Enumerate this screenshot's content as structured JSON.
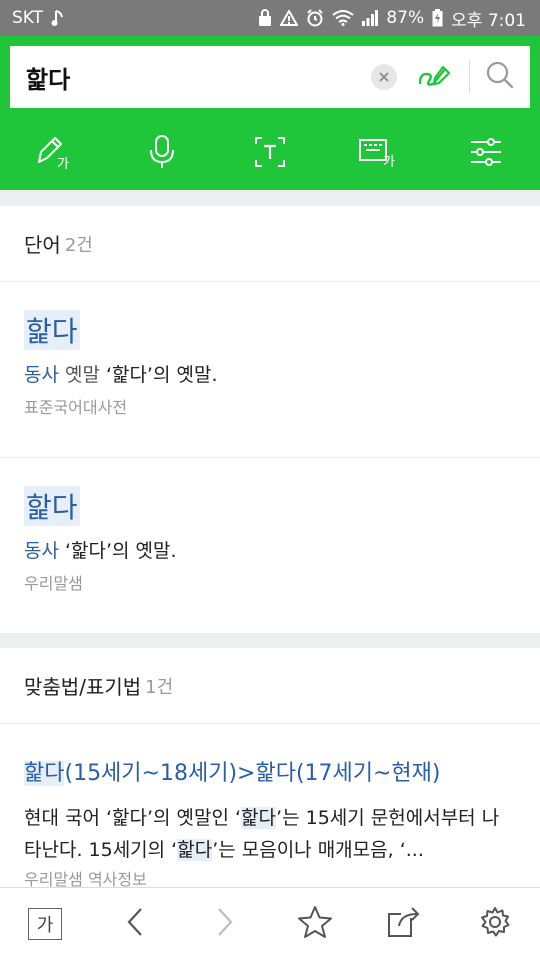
{
  "status_bar": {
    "carrier": "SKT",
    "battery": "87%",
    "time": "오후 7:01"
  },
  "search": {
    "query": "핥다",
    "icons": [
      "clear-icon",
      "handwriting-pen-icon",
      "search-icon"
    ]
  },
  "toolbar": {
    "tools": [
      "handwriting-input-icon",
      "microphone-icon",
      "text-recognition-icon",
      "keyboard-korean-icon",
      "settings-sliders-icon"
    ]
  },
  "words_section": {
    "title": "단어",
    "count": "2건",
    "entries": [
      {
        "word": "핥다",
        "pos": "동사",
        "sub": "옛말",
        "definition": "‘핥다’의 옛말.",
        "source": "표준국어대사전"
      },
      {
        "word": "핥다",
        "pos": "동사",
        "definition": "‘핥다’의 옛말.",
        "source": "우리말샘"
      }
    ]
  },
  "spelling_section": {
    "title": "맞춤법/표기법",
    "count": "1건",
    "entry": {
      "title_a": "핥다",
      "title_b": "(15세기~18세기)>핥다(17세기~현재)",
      "body_1": "현대 국어 ‘핥다’의 옛말인 ‘",
      "body_hl_1": "핥다",
      "body_2": "’는 15세기 문헌에서부터 나타난다. 15세기의 ‘",
      "body_hl_2": "핥다",
      "body_3": "’는 모음이나 매개모음, ‘...",
      "source": "우리말샘 역사정보"
    }
  },
  "bottom_bar": {
    "font_label": "가",
    "icons": [
      "font-size-icon",
      "back-icon",
      "forward-icon",
      "bookmark-star-icon",
      "share-icon",
      "gear-icon"
    ]
  }
}
